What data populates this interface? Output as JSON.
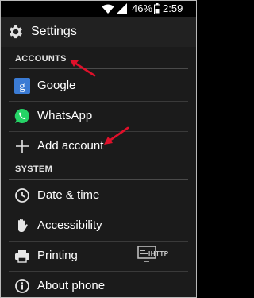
{
  "status_bar": {
    "battery_percent": "46%",
    "time": "2:59 PM"
  },
  "header": {
    "title": "Settings",
    "icon": "gear-icon"
  },
  "sections": {
    "accounts": {
      "label": "ACCOUNTS",
      "items": [
        {
          "label": "Google",
          "icon": "google-icon"
        },
        {
          "label": "WhatsApp",
          "icon": "whatsapp-icon"
        },
        {
          "label": "Add account",
          "icon": "plus-icon"
        }
      ]
    },
    "system": {
      "label": "SYSTEM",
      "items": [
        {
          "label": "Date & time",
          "icon": "clock-icon"
        },
        {
          "label": "Accessibility",
          "icon": "hand-icon"
        },
        {
          "label": "Printing",
          "icon": "printer-icon"
        },
        {
          "label": "About phone",
          "icon": "info-icon"
        }
      ]
    }
  },
  "watermark": {
    "text": "IHTTP"
  },
  "colors": {
    "annotation_red": "#e0102a",
    "google_blue": "#3b7bd4",
    "whatsapp_green": "#25d366"
  }
}
